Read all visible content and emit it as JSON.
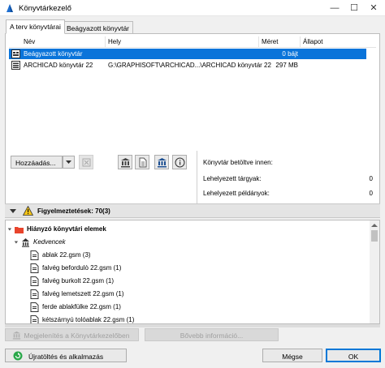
{
  "window": {
    "title": "Könyvtárkezelő",
    "minimize_glyph": "—",
    "maximize_glyph": "☐",
    "close_glyph": "✕"
  },
  "tabs": [
    {
      "label": "A terv könyvtárai",
      "active": true
    },
    {
      "label": "Beágyazott könyvtár",
      "active": false
    }
  ],
  "library_list": {
    "columns": [
      "Név",
      "Hely",
      "Méret",
      "Állapot"
    ],
    "rows": [
      {
        "name": "Beágyazott könyvtár",
        "location": "",
        "size": "0 bájt",
        "status": "",
        "selected": true,
        "icon": "embedded-library-icon"
      },
      {
        "name": "ARCHICAD könyvtár 22",
        "location": "G:\\GRAPHISOFT\\ARCHICAD...\\ARCHICAD könyvtár 22",
        "size": "297 MB",
        "status": "",
        "selected": false,
        "icon": "library-icon"
      }
    ]
  },
  "toolbar": {
    "add_label": "Hozzáadás...",
    "add_dropdown_icon": "chevron-down-icon",
    "remove_icon": "remove-library-icon",
    "icons": [
      "library-manage-icon",
      "document-icon",
      "bimcomponents-icon",
      "info-icon"
    ]
  },
  "info_panel": {
    "loaded_from_label": "Könyvtár betöltve innen:",
    "placed_objects_label": "Lehelyezett tárgyak:",
    "placed_objects_value": "0",
    "placed_instances_label": "Lehelyezett példányok:",
    "placed_instances_value": "0"
  },
  "warnings": {
    "label": "Figyelmeztetések: 70(3)",
    "tree": [
      {
        "label": "Hiányzó könyvtári elemek",
        "level": 0,
        "icon": "folder-missing-icon",
        "bold": true,
        "expanded": true
      },
      {
        "label": "Kedvencek",
        "level": 1,
        "icon": "favorites-icon",
        "italic": true,
        "expanded": true
      },
      {
        "label": "ablak 22.gsm (3)",
        "level": 2,
        "icon": "file-icon"
      },
      {
        "label": "falvég befordulò 22.gsm (1)",
        "level": 2,
        "icon": "file-icon"
      },
      {
        "label": "falvég burkolt 22.gsm (1)",
        "level": 2,
        "icon": "file-icon"
      },
      {
        "label": "falvég lemetszett 22.gsm (1)",
        "level": 2,
        "icon": "file-icon"
      },
      {
        "label": "ferde ablakfülke 22.gsm (1)",
        "level": 2,
        "icon": "file-icon"
      },
      {
        "label": "kétszárnyú tolóablak 22.gsm (1)",
        "level": 2,
        "icon": "file-icon"
      }
    ]
  },
  "bottom_actions": {
    "show_in_manager": "Megjelenítés a Könyvtárkezelőben",
    "more_info": "Bővebb információ..."
  },
  "footer": {
    "reload_label": "Újratöltés és alkalmazás",
    "cancel_label": "Mégse",
    "ok_label": "OK"
  },
  "colors": {
    "selection": "#0a74da",
    "ok_border": "#0078d7",
    "folder_red": "#e8442c",
    "warning_yellow": "#f5c518"
  }
}
